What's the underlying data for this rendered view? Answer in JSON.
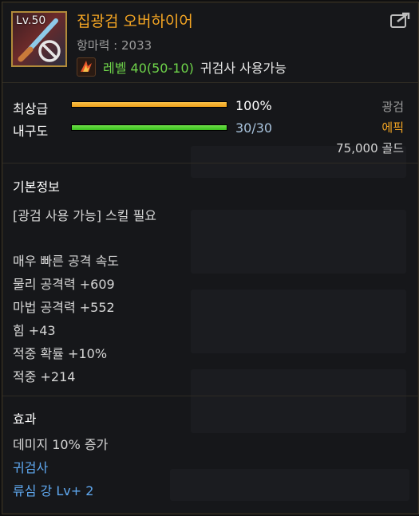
{
  "item": {
    "level_badge": "Lv.50",
    "name": "집광검 오버하이어",
    "defense": "항마력 : 2033",
    "required_level": "레벨 40(50-10)",
    "required_class": "귀검사 사용가능"
  },
  "grade": {
    "quality_label": "최상급",
    "quality_value": "100%",
    "quality_fraction": 1.0,
    "durability_label": "내구도",
    "durability_value": "30/30",
    "durability_fraction": 1.0,
    "weapon_type": "광검",
    "rarity": "에픽",
    "price": "75,000 골드"
  },
  "basic_info": {
    "heading": "기본정보",
    "skill_req": "[광검 사용 가능] 스킬 필요",
    "stats": [
      "매우 빠른 공격 속도",
      "물리 공격력 +609",
      "마법 공격력 +552",
      "힘 +43",
      "적중 확률 +10%",
      "적중 +214"
    ]
  },
  "effect": {
    "heading": "효과",
    "damage": "데미지 10% 증가",
    "class_name": "귀검사",
    "skill_bonus": "류심 강 Lv+ 2"
  },
  "colors": {
    "title": "#f5a623",
    "rarity": "#f5a623",
    "req_level": "#6fd54a",
    "quality_bar": "#f0a21a",
    "durability_bar": "#3cc21f",
    "effect_text": "#5fa8f0"
  },
  "icons": [
    "lightsword-item-icon",
    "no-sign-icon",
    "class-emblem-icon",
    "share-icon"
  ]
}
